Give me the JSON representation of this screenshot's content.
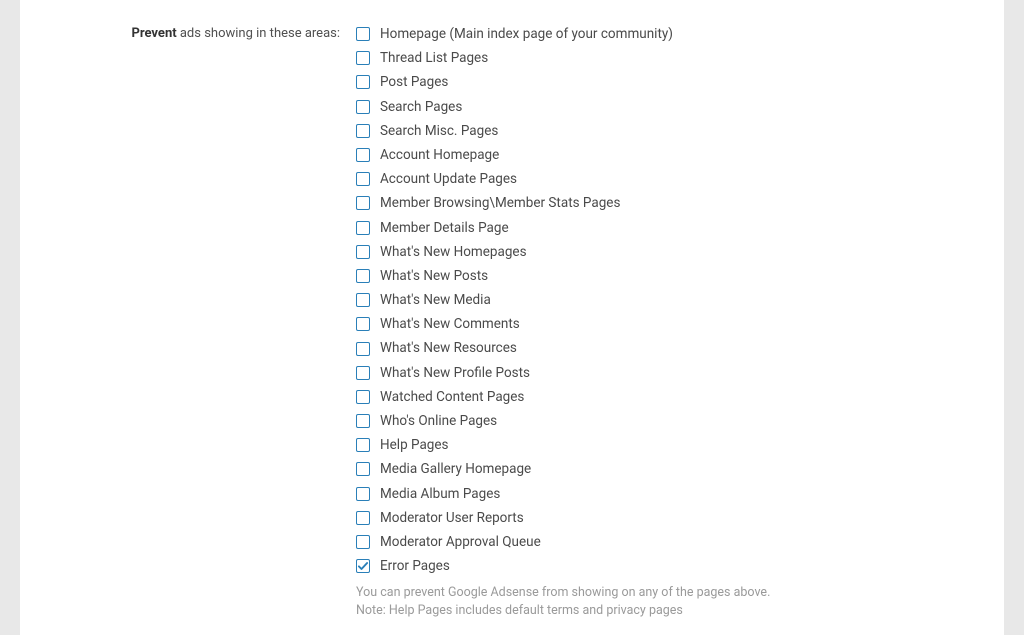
{
  "label": {
    "strong": "Prevent",
    "rest": " ads showing in these areas:"
  },
  "options": [
    {
      "label": "Homepage (Main index page of your community)",
      "checked": false,
      "name": "homepage"
    },
    {
      "label": "Thread List Pages",
      "checked": false,
      "name": "thread-list-pages"
    },
    {
      "label": "Post Pages",
      "checked": false,
      "name": "post-pages"
    },
    {
      "label": "Search Pages",
      "checked": false,
      "name": "search-pages"
    },
    {
      "label": "Search Misc. Pages",
      "checked": false,
      "name": "search-misc-pages"
    },
    {
      "label": "Account Homepage",
      "checked": false,
      "name": "account-homepage"
    },
    {
      "label": "Account Update Pages",
      "checked": false,
      "name": "account-update-pages"
    },
    {
      "label": "Member Browsing\\Member Stats Pages",
      "checked": false,
      "name": "member-browsing-stats"
    },
    {
      "label": "Member Details Page",
      "checked": false,
      "name": "member-details-page"
    },
    {
      "label": "What's New Homepages",
      "checked": false,
      "name": "whats-new-homepages"
    },
    {
      "label": "What's New Posts",
      "checked": false,
      "name": "whats-new-posts"
    },
    {
      "label": "What's New Media",
      "checked": false,
      "name": "whats-new-media"
    },
    {
      "label": "What's New Comments",
      "checked": false,
      "name": "whats-new-comments"
    },
    {
      "label": "What's New Resources",
      "checked": false,
      "name": "whats-new-resources"
    },
    {
      "label": "What's New Profile Posts",
      "checked": false,
      "name": "whats-new-profile-posts"
    },
    {
      "label": "Watched Content Pages",
      "checked": false,
      "name": "watched-content-pages"
    },
    {
      "label": "Who's Online Pages",
      "checked": false,
      "name": "whos-online-pages"
    },
    {
      "label": "Help Pages",
      "checked": false,
      "name": "help-pages"
    },
    {
      "label": "Media Gallery Homepage",
      "checked": false,
      "name": "media-gallery-homepage"
    },
    {
      "label": "Media Album Pages",
      "checked": false,
      "name": "media-album-pages"
    },
    {
      "label": "Moderator User Reports",
      "checked": false,
      "name": "moderator-user-reports"
    },
    {
      "label": "Moderator Approval Queue",
      "checked": false,
      "name": "moderator-approval-queue"
    },
    {
      "label": "Error Pages",
      "checked": true,
      "name": "error-pages"
    }
  ],
  "hint": {
    "line1": "You can prevent Google Adsense from showing on any of the pages above.",
    "line2": "Note: Help Pages includes default terms and privacy pages"
  }
}
